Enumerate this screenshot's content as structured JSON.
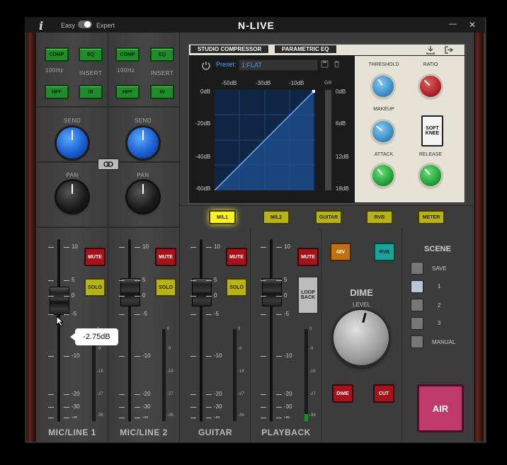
{
  "titlebar": {
    "info_glyph": "i",
    "mode_left": "Easy",
    "mode_right": "Expert",
    "title": "N-LIVE",
    "minimize_glyph": "—",
    "close_glyph": "✕"
  },
  "channels": [
    {
      "name": "MIC/LINE 1",
      "comp": "COMP",
      "eq": "EQ",
      "hpf": "HPF",
      "in": "IN",
      "freq": "100Hz",
      "insert": "INSERT",
      "send": "SEND",
      "pan": "PAN",
      "mute": "MUTE",
      "solo": "SOLO"
    },
    {
      "name": "MIC/LINE 2",
      "comp": "COMP",
      "eq": "EQ",
      "hpf": "HPF",
      "in": "IN",
      "freq": "100Hz",
      "insert": "INSERT",
      "send": "SEND",
      "pan": "PAN",
      "mute": "MUTE",
      "solo": "SOLO"
    },
    {
      "name": "GUITAR",
      "mute": "MUTE",
      "solo": "SOLO"
    },
    {
      "name": "PLAYBACK",
      "mute": "MUTE",
      "loopback": "LOOP BACK"
    }
  ],
  "fader_scale": [
    "10",
    "5",
    "0",
    "-5",
    "-10",
    "-20",
    "-30",
    "-∞"
  ],
  "meter_scale": [
    "0",
    "-9",
    "-18",
    "-27",
    "-36"
  ],
  "tooltip": "-2.75dB",
  "compressor": {
    "tab_active": "STUDIO COMPRESSOR",
    "tab_inactive": "PARAMETRIC EQ",
    "preset_label": "Preset:",
    "preset_value": "1:FLAT",
    "x_ticks": [
      "-50dB",
      "-30dB",
      "-10dB"
    ],
    "y_ticks": [
      "0dB",
      "-20dB",
      "-40dB",
      "-60dB"
    ],
    "gr_label": "GR",
    "gr_ticks": [
      "0dB",
      "6dB",
      "12dB",
      "18dB"
    ],
    "threshold": "THRESHOLD",
    "ratio": "RATIO",
    "makeup": "MAKEUP",
    "soft_knee": "SOFT KNEE",
    "attack": "ATTACK",
    "release": "RELEASE"
  },
  "route_buttons": [
    "M/L1",
    "M/L2",
    "GUITAR",
    "RVB",
    "METER"
  ],
  "route_active": "M/L1",
  "center": {
    "phantom": "48V",
    "rvb": "RVB",
    "dime_title": "DIME",
    "level": "LEVEL",
    "dime_btn": "DIME",
    "cut_btn": "CUT"
  },
  "scene": {
    "title": "SCENE",
    "items": [
      "SAVE",
      "1",
      "2",
      "3",
      "MANUAL"
    ]
  },
  "air": "AIR",
  "colors": {
    "accent_blue": "#1a5fd0",
    "green": "#1f8c2a",
    "red": "#a5121a",
    "yellow": "#b9b214",
    "air": "#c0396b"
  }
}
